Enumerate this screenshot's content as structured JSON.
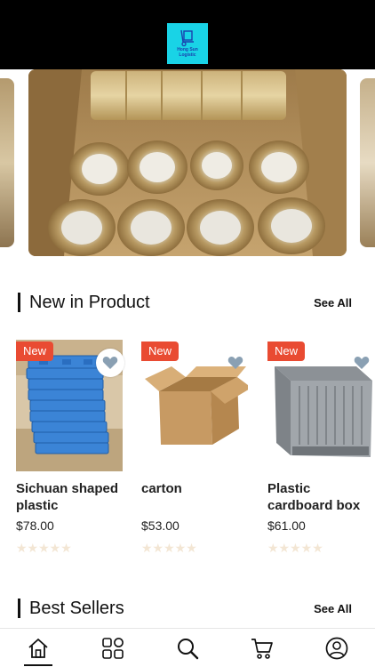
{
  "header": {
    "logo_text_line1": "Hong Sun",
    "logo_text_line2": "Logistic"
  },
  "sections": {
    "new_in": {
      "title": "New in Product",
      "see_all": "See All"
    },
    "best_sellers": {
      "title": "Best Sellers",
      "see_all": "See All"
    }
  },
  "products": [
    {
      "badge": "New",
      "name": "Sichuan shaped plastic",
      "price": "$78.00",
      "stars": "★★★★★",
      "favorite_style": "circle"
    },
    {
      "badge": "New",
      "name": "carton",
      "price": "$53.00",
      "stars": "★★★★★",
      "favorite_style": "plain"
    },
    {
      "badge": "New",
      "name": "Plastic cardboard box",
      "price": "$61.00",
      "stars": "★★★★★",
      "favorite_style": "plain"
    }
  ],
  "colors": {
    "badge": "#e94b32",
    "logo_bg": "#19d3e6",
    "heart": "#8aa0b3",
    "star_empty": "#f3e6d4"
  },
  "nav": [
    {
      "icon": "home-icon",
      "active": true
    },
    {
      "icon": "grid-icon",
      "active": false
    },
    {
      "icon": "search-icon",
      "active": false
    },
    {
      "icon": "cart-icon",
      "active": false
    },
    {
      "icon": "profile-icon",
      "active": false
    }
  ]
}
